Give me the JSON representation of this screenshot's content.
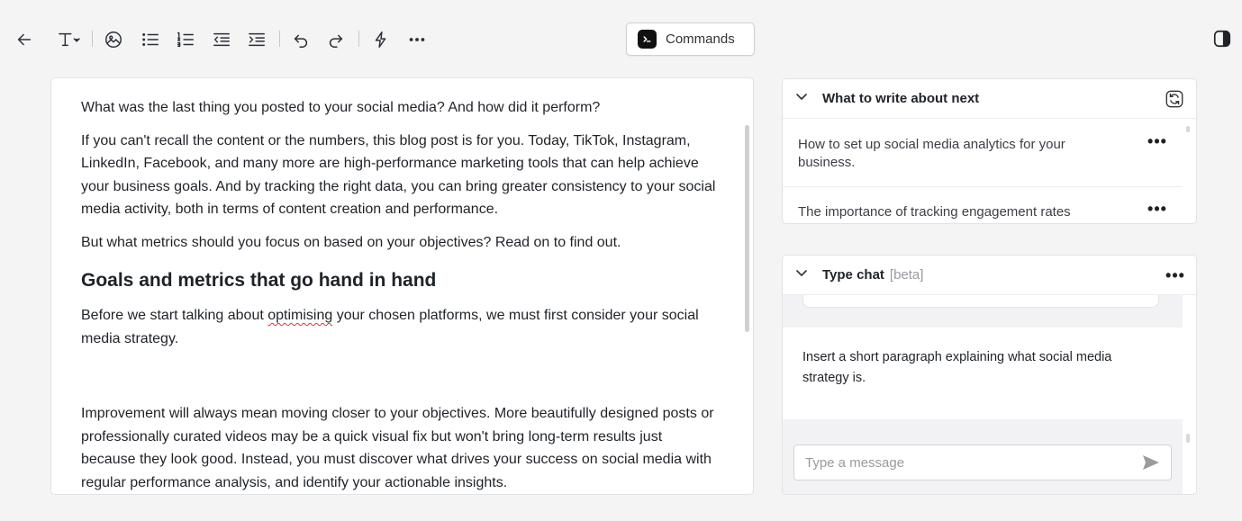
{
  "toolbar": {
    "commands_label": "Commands"
  },
  "editor": {
    "p1": "What was the last thing you posted to your social media? And how did it perform?",
    "p2": "If you can't recall the content or the numbers, this blog post is for you. Today, TikTok, Instagram, LinkedIn, Facebook, and many more are high-performance marketing tools that can help achieve your business goals. And by tracking the right data, you can bring greater consistency to your social media activity, both in terms of content creation and performance.",
    "p3": "But what metrics should you focus on based on your objectives? Read on to find out.",
    "h2": "Goals and metrics that go hand in hand",
    "p4_before": "Before we start talking about ",
    "p4_misspelled": "optimising",
    "p4_after": " your chosen platforms, we must first consider your social media strategy.",
    "p5": " Improvement will always mean moving closer to your objectives. More beautifully designed posts or professionally curated videos may be a quick visual fix but won't bring long-term results just because they look good. Instead, you must discover what drives your success on social media with regular performance analysis, and identify your actionable insights."
  },
  "next_panel": {
    "title": "What to write about next",
    "items": [
      {
        "text": "How to set up social media analytics for your business."
      },
      {
        "text": "The importance of tracking engagement rates"
      }
    ]
  },
  "chat_panel": {
    "title": "Type chat",
    "tag": "[beta]",
    "message": "Insert a short paragraph explaining what social media strategy is.",
    "input_placeholder": "Type a message"
  },
  "icons": {
    "more": "•••"
  }
}
